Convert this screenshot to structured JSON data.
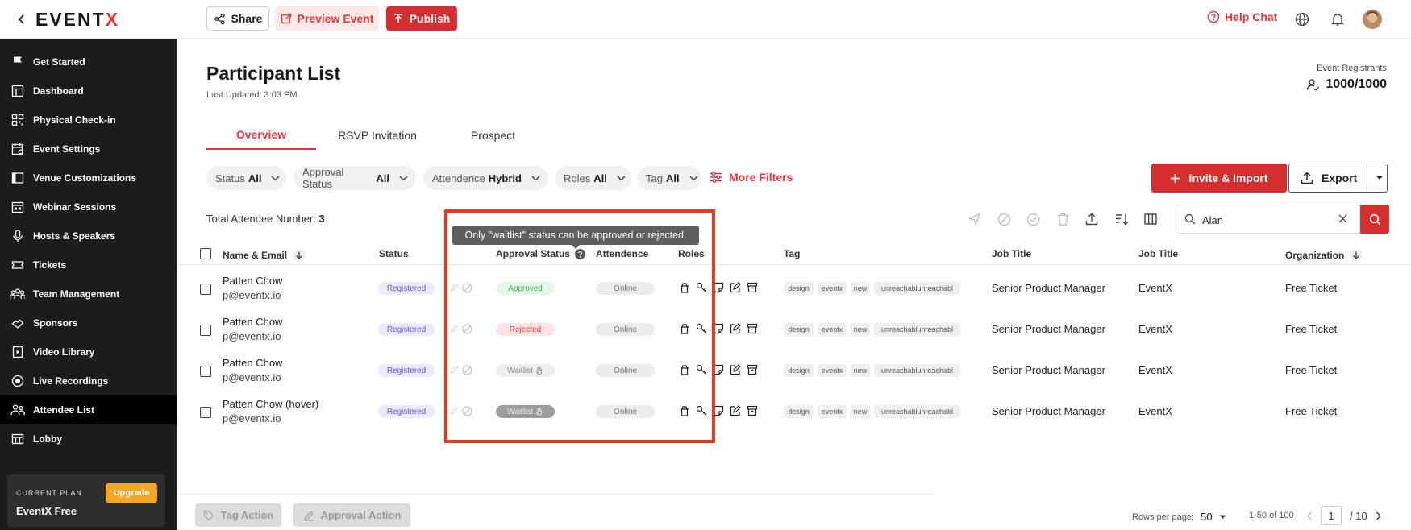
{
  "topbar": {
    "logo_text": "EVENT",
    "logo_accent": "X",
    "share_label": "Share",
    "preview_label": "Preview Event",
    "publish_label": "Publish",
    "help_label": "Help Chat"
  },
  "sidebar": {
    "items": [
      {
        "label": "Get Started",
        "icon": "flag-icon"
      },
      {
        "label": "Dashboard",
        "icon": "dashboard-icon"
      },
      {
        "label": "Physical Check-in",
        "icon": "qr-code-icon"
      },
      {
        "label": "Event Settings",
        "icon": "calendar-settings-icon"
      },
      {
        "label": "Venue Customizations",
        "icon": "layout-icon"
      },
      {
        "label": "Webinar Sessions",
        "icon": "webinar-icon"
      },
      {
        "label": "Hosts & Speakers",
        "icon": "microphone-icon"
      },
      {
        "label": "Tickets",
        "icon": "ticket-icon"
      },
      {
        "label": "Team Management",
        "icon": "team-icon"
      },
      {
        "label": "Sponsors",
        "icon": "sponsor-icon"
      },
      {
        "label": "Video Library",
        "icon": "video-icon"
      },
      {
        "label": "Live Recordings",
        "icon": "record-icon"
      },
      {
        "label": "Attendee List",
        "icon": "attendees-icon"
      },
      {
        "label": "Lobby",
        "icon": "lobby-icon"
      }
    ],
    "active_item": "Attendee List",
    "plan_label": "CURRENT PLAN",
    "plan_name": "EventX Free",
    "upgrade_label": "Upgrade"
  },
  "header": {
    "title": "Participant List",
    "last_updated": "Last Updated: 3:03 PM",
    "registrants_label": "Event Registrants",
    "registrants_count": "1000/1000"
  },
  "tabs": [
    {
      "label": "Overview",
      "active": true
    },
    {
      "label": "RSVP Invitation",
      "active": false
    },
    {
      "label": "Prospect",
      "active": false
    }
  ],
  "filters": [
    {
      "label": "Status",
      "value": "All"
    },
    {
      "label": "Approval Status",
      "value": "All"
    },
    {
      "label": "Attendence",
      "value": "Hybrid"
    },
    {
      "label": "Roles",
      "value": "All"
    },
    {
      "label": "Tag",
      "value": "All"
    }
  ],
  "more_filters_label": "More Filters",
  "invite_label": "Invite & Import",
  "export_label": "Export",
  "total_label": "Total Attendee Number:",
  "total_value": "3",
  "search": {
    "value": "Alan"
  },
  "tooltip": "Only \"waitlist\" status can be approved or rejected.",
  "columns": {
    "name_email": "Name & Email",
    "status": "Status",
    "approval_status": "Approval Status",
    "attendence": "Attendence",
    "roles": "Roles",
    "tag": "Tag",
    "job_title_1": "Job Title",
    "job_title_2": "Job Title",
    "organization": "Organization"
  },
  "rows": [
    {
      "name": "Patten Chow",
      "email": "p@eventx.io",
      "status": "Registered",
      "approval": "Approved",
      "attendence": "Online",
      "tags": [
        "design",
        "eventx",
        "new",
        "unreachablunreachabl"
      ],
      "job_title_1": "Senior Product Manager",
      "job_title_2": "EventX",
      "organization": "Free Ticket"
    },
    {
      "name": "Patten Chow",
      "email": "p@eventx.io",
      "status": "Registered",
      "approval": "Rejected",
      "attendence": "Online",
      "tags": [
        "design",
        "eventx",
        "new",
        "unreachablunreachabl"
      ],
      "job_title_1": "Senior Product Manager",
      "job_title_2": "EventX",
      "organization": "Free Ticket"
    },
    {
      "name": "Patten Chow",
      "email": "p@eventx.io",
      "status": "Registered",
      "approval": "Waitlist",
      "attendence": "Online",
      "tags": [
        "design",
        "eventx",
        "new",
        "unreachablunreachabl"
      ],
      "job_title_1": "Senior Product Manager",
      "job_title_2": "EventX",
      "organization": "Free Ticket"
    },
    {
      "name": "Patten Chow (hover)",
      "email": "p@eventx.io",
      "status": "Registered",
      "approval": "Waitlist",
      "attendence": "Online",
      "tags": [
        "design",
        "eventx",
        "new",
        "unreachablunreachabl"
      ],
      "job_title_1": "Senior Product Manager",
      "job_title_2": "EventX",
      "organization": "Free Ticket"
    }
  ],
  "footer": {
    "tag_action": "Tag Action",
    "approval_action": "Approval Action",
    "rows_per_page_label": "Rows per page:",
    "rows_per_page_value": "50",
    "range": "1-50 of 100",
    "current_page": "1",
    "total_pages": "/ 10"
  },
  "colors": {
    "accent": "#d32f2f",
    "sidebar_bg": "#1c1c1c",
    "highlight": "#e23b25"
  }
}
